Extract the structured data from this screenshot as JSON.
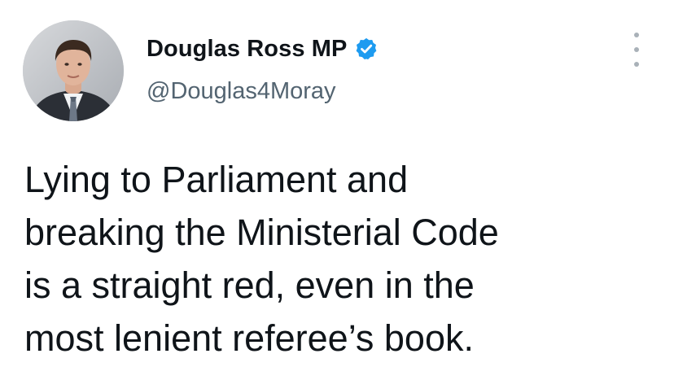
{
  "author": {
    "display_name": "Douglas Ross MP",
    "handle": "@Douglas4Moray",
    "verified": true,
    "avatar_icon": "profile-photo"
  },
  "tweet": {
    "lines": [
      "Lying to Parliament and",
      "breaking the Ministerial Code",
      "is a straight red, even in the",
      "most lenient referee’s book."
    ]
  },
  "icons": {
    "verified": "verified-badge-icon",
    "more": "more-options-icon"
  },
  "colors": {
    "verified_blue": "#1d9bf0",
    "text_primary": "#0f1419",
    "text_secondary": "#536471"
  }
}
